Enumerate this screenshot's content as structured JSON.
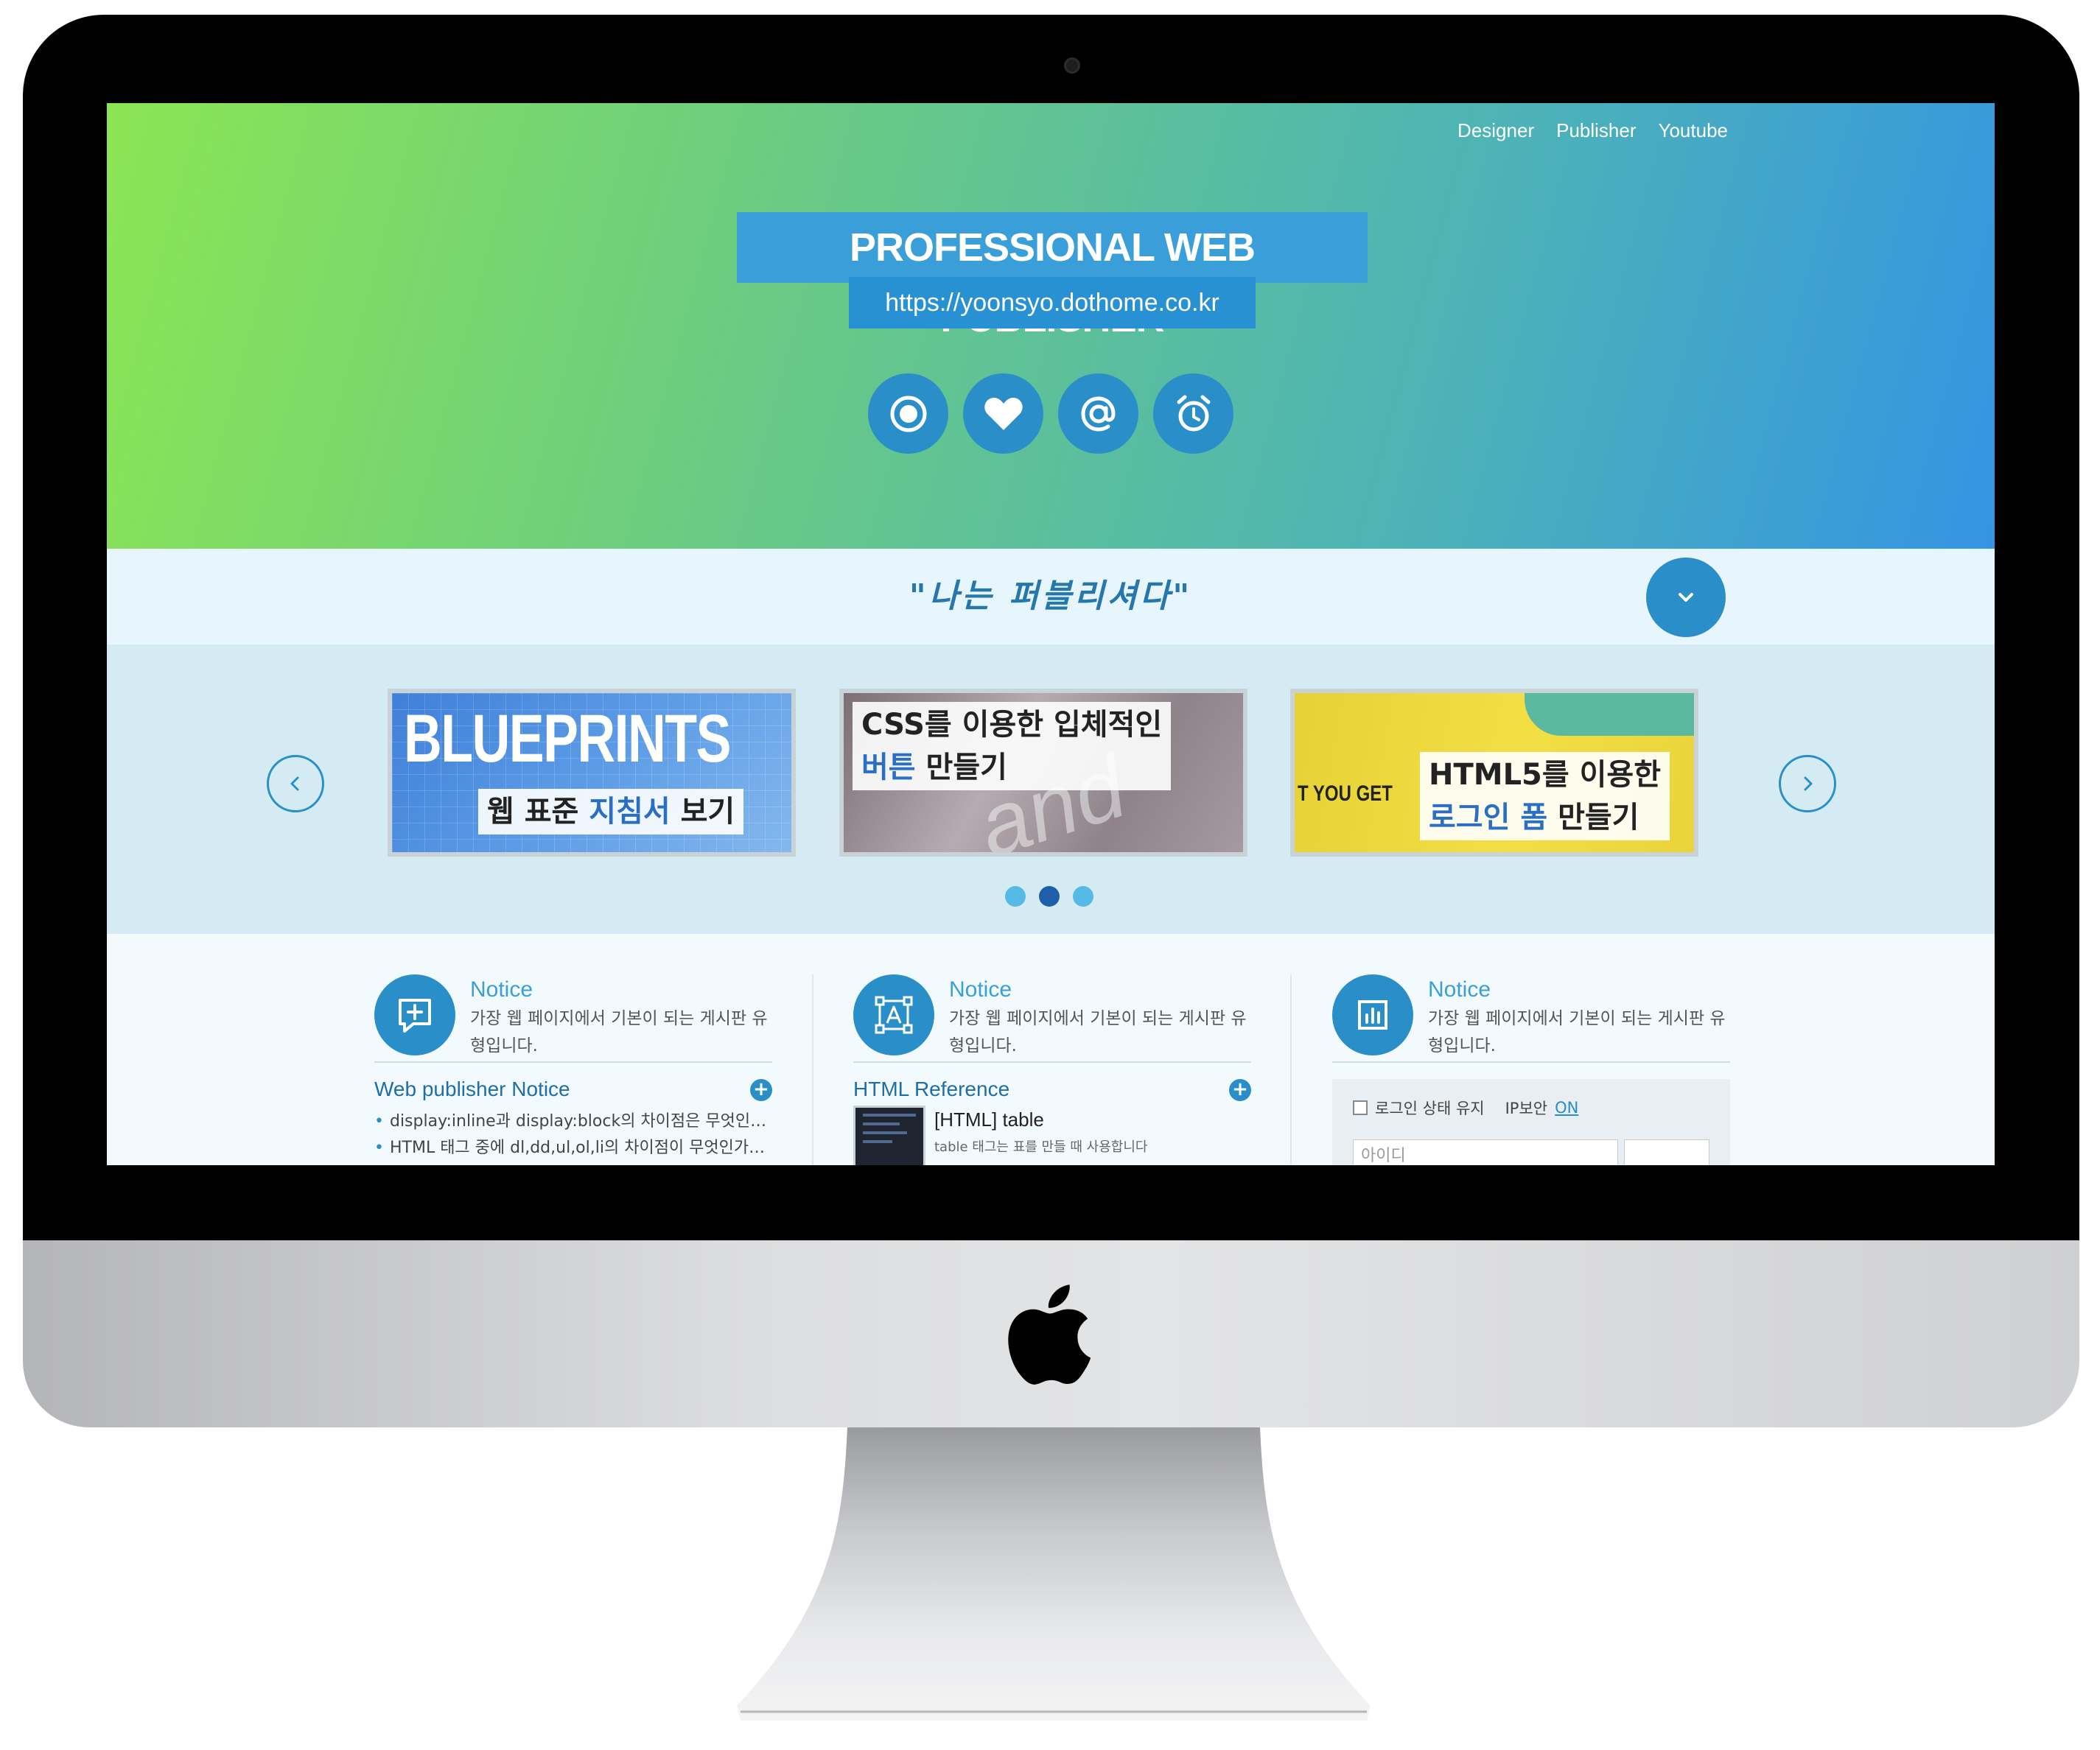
{
  "nav": {
    "items": [
      {
        "label": "Designer"
      },
      {
        "label": "Publisher"
      },
      {
        "label": "Youtube"
      }
    ]
  },
  "hero": {
    "title": "PROFESSIONAL WEB PUBLISHER",
    "url": "https://yoonsyo.dothome.co.kr",
    "icons": [
      "target-icon",
      "heart-icon",
      "at-sign-icon",
      "alarm-clock-icon"
    ]
  },
  "quote": {
    "text": "\"나는 퍼블리셔다\""
  },
  "slider": {
    "slides": [
      {
        "big_text": "BLUEPRINTS",
        "caption_plain": "웹 표준 ",
        "caption_highlight": "지침서",
        "caption_tail": " 보기"
      },
      {
        "deco_text": "and inte",
        "caption_line1": "CSS를 이용한 입체적인",
        "caption_line2_highlight": "버튼",
        "caption_line2_tail": " 만들기"
      },
      {
        "side_text": "T YOU GET",
        "caption_line1": "HTML5를 이용한",
        "caption_line2_highlight": "로그인 폼",
        "caption_line2_tail": " 만들기"
      }
    ],
    "active_index": 1,
    "dot_count": 3
  },
  "columns": [
    {
      "title": "Notice",
      "description": "가장 웹 페이지에서 기본이 되는 게시판 유형입니다.",
      "icon": "add-comment-icon",
      "section_title": "Web publisher Notice",
      "items": [
        "display:inline과 display:block의 차이점은 무엇인가...",
        "HTML 태그 중에 dl,dd,ul,ol,li의 차이점이 무엇인가요?"
      ]
    },
    {
      "title": "Notice",
      "description": "가장 웹 페이지에서 기본이 되는 게시판 유형입니다.",
      "icon": "text-frame-icon",
      "section_title": "HTML Reference",
      "ref_title": "[HTML] table",
      "ref_desc": "table 태그는 표를 만들 때 사용합니다"
    },
    {
      "title": "Notice",
      "description": "가장 웹 페이지에서 기본이 되는 게시판 유형입니다.",
      "icon": "bar-chart-icon",
      "login": {
        "keep_label": "로그인 상태 유지",
        "ip_label": "IP보안",
        "ip_state": "ON",
        "id_placeholder": "아이디"
      }
    }
  ],
  "colors": {
    "accent": "#2a8fc9",
    "hero_start": "#8be553",
    "hero_end": "#3594e3",
    "quote_text": "#2577ad"
  }
}
